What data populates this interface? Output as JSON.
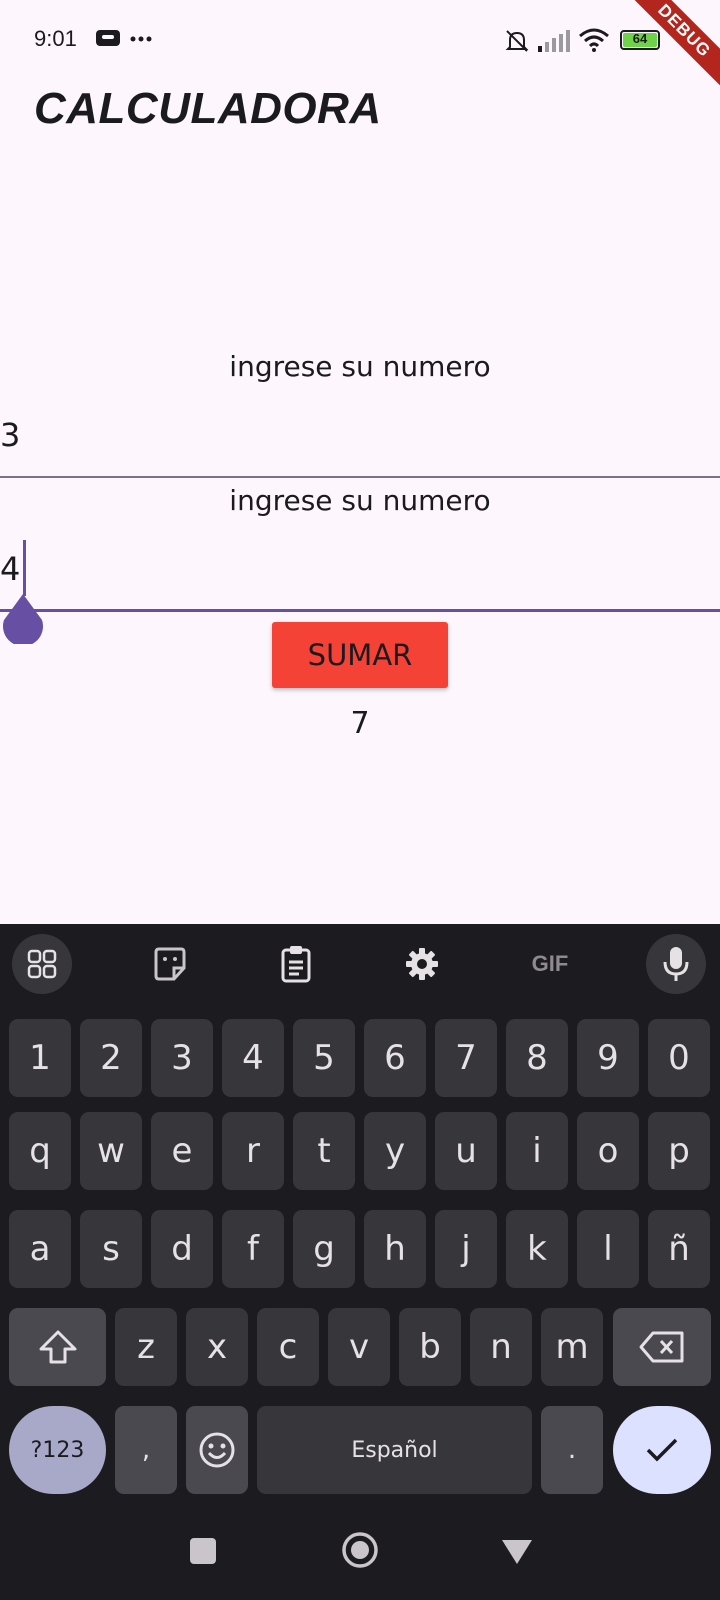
{
  "status_bar": {
    "time": "9:01",
    "battery": "64",
    "debug_banner": "DEBUG"
  },
  "app": {
    "title": "CALCULADORA",
    "field1": {
      "label": "ingrese su numero",
      "value": "3"
    },
    "field2": {
      "label": "ingrese su numero",
      "value": "4"
    },
    "button_label": "SUMAR",
    "result": "7"
  },
  "keyboard": {
    "toolbar": [
      "apps-icon",
      "sticker-icon",
      "clipboard-icon",
      "settings-icon",
      "gif-icon",
      "mic-icon"
    ],
    "gif_label": "GIF",
    "row1": [
      "1",
      "2",
      "3",
      "4",
      "5",
      "6",
      "7",
      "8",
      "9",
      "0"
    ],
    "row2": [
      "q",
      "w",
      "e",
      "r",
      "t",
      "y",
      "u",
      "i",
      "o",
      "p"
    ],
    "row3": [
      "a",
      "s",
      "d",
      "f",
      "g",
      "h",
      "j",
      "k",
      "l",
      "ñ"
    ],
    "row4": [
      "z",
      "x",
      "c",
      "v",
      "b",
      "n",
      "m"
    ],
    "symbols_label": "?123",
    "comma": ",",
    "space_label": "Español",
    "period": "."
  },
  "colors": {
    "accent": "#6750a4",
    "button": "#f44336",
    "background": "#fdf7fd",
    "keyboard_bg": "#1c1b20"
  }
}
